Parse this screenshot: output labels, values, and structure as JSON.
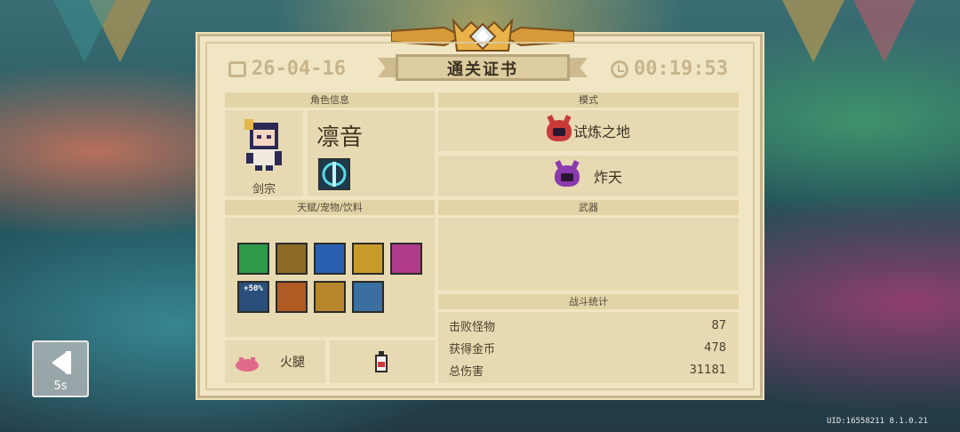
{
  "certificate": {
    "title": "通关证书",
    "date": "26-04-16",
    "time": "00:19:53"
  },
  "character": {
    "section_label": "角色信息",
    "name": "凛音",
    "class": "剑宗"
  },
  "mode": {
    "section_label": "模式",
    "primary": "试炼之地",
    "secondary": "炸天"
  },
  "buffs": {
    "section_label": "天赋/宠物/饮料",
    "icons": [
      {
        "name": "shield-green-buff",
        "color": "#2f9b4a"
      },
      {
        "name": "lightning-buff",
        "color": "#8a6a24"
      },
      {
        "name": "blue-orb-buff",
        "color": "#2a5fb0"
      },
      {
        "name": "gold-shield-buff",
        "color": "#c79a2a"
      },
      {
        "name": "pink-heart-buff",
        "color": "#b03a8a"
      },
      {
        "name": "percent-buff",
        "color": "#2a4f7a",
        "label": "+50%"
      },
      {
        "name": "fist-buff",
        "color": "#b05a24"
      },
      {
        "name": "fire-shield-buff",
        "color": "#b7862a"
      },
      {
        "name": "meditation-buff",
        "color": "#3a6fa0"
      }
    ],
    "pet_name": "火腿"
  },
  "weapon": {
    "section_label": "武器"
  },
  "combat": {
    "section_label": "战斗统计",
    "rows": [
      {
        "label": "击败怪物",
        "value": "87"
      },
      {
        "label": "获得金币",
        "value": "478"
      },
      {
        "label": "总伤害",
        "value": "31181"
      }
    ]
  },
  "back_button": {
    "countdown": "5s"
  },
  "footer": {
    "uid": "UID:16558211 8.1.0.21"
  },
  "colors": {
    "card_bg": "#f1e6c4",
    "section_bar": "#e3d4a8",
    "panel_bg": "#e7dab2",
    "gold": "#d79a3a"
  }
}
